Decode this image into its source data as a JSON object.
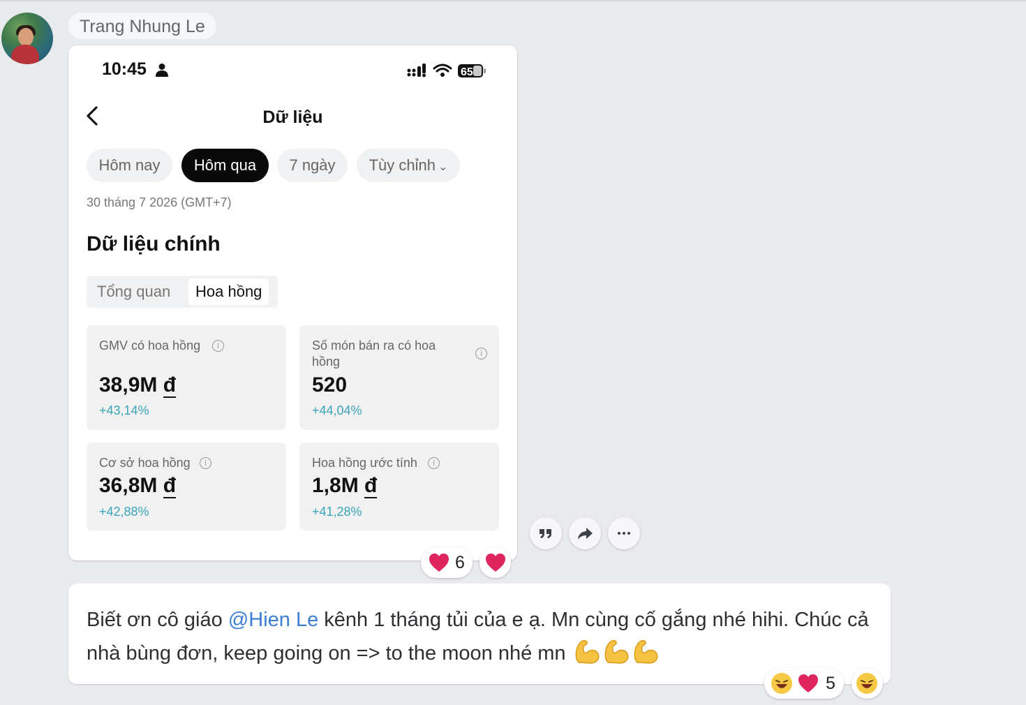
{
  "sender": {
    "name": "Trang Nhung Le"
  },
  "phone": {
    "time": "10:45",
    "battery": "65",
    "screen_title": "Dữ liệu",
    "chips": [
      "Hôm nay",
      "Hôm qua",
      "7 ngày",
      "Tùy chỉnh"
    ],
    "active_chip": "Hôm qua",
    "date": "30 tháng 7 2026 (GMT+7)",
    "section_title": "Dữ liệu chính",
    "segments": [
      "Tổng quan",
      "Hoa hồng"
    ],
    "active_segment": "Hoa hồng",
    "metrics": [
      {
        "label": "GMV có hoa hồng",
        "value_num": "38,9M",
        "currency": "đ",
        "change": "+43,14%"
      },
      {
        "label": "Số món bán ra có hoa hồng",
        "value_num": "520",
        "currency": "",
        "change": "+44,04%"
      },
      {
        "label": "Cơ sở hoa hồng",
        "value_num": "36,8M",
        "currency": "đ",
        "change": "+42,88%"
      },
      {
        "label": "Hoa hồng ước tính",
        "value_num": "1,8M",
        "currency": "đ",
        "change": "+41,28%"
      }
    ]
  },
  "reactions_first": {
    "count": "6"
  },
  "message2": {
    "text_before": "Biết ơn cô giáo ",
    "mention": "@Hien Le",
    "text_after": " kênh 1 tháng tủi của e ạ. Mn cùng cố gắng nhé hihi. Chúc cả nhà bùng đơn, keep going on => to the moon nhé mn",
    "emoji": [
      "flexed-biceps",
      "flexed-biceps",
      "flexed-biceps"
    ]
  },
  "reactions_second": {
    "count": "5"
  },
  "colors": {
    "accent_link": "#3c7ed6",
    "positive_change": "#3aa5b8",
    "heart": "#e0245e"
  }
}
